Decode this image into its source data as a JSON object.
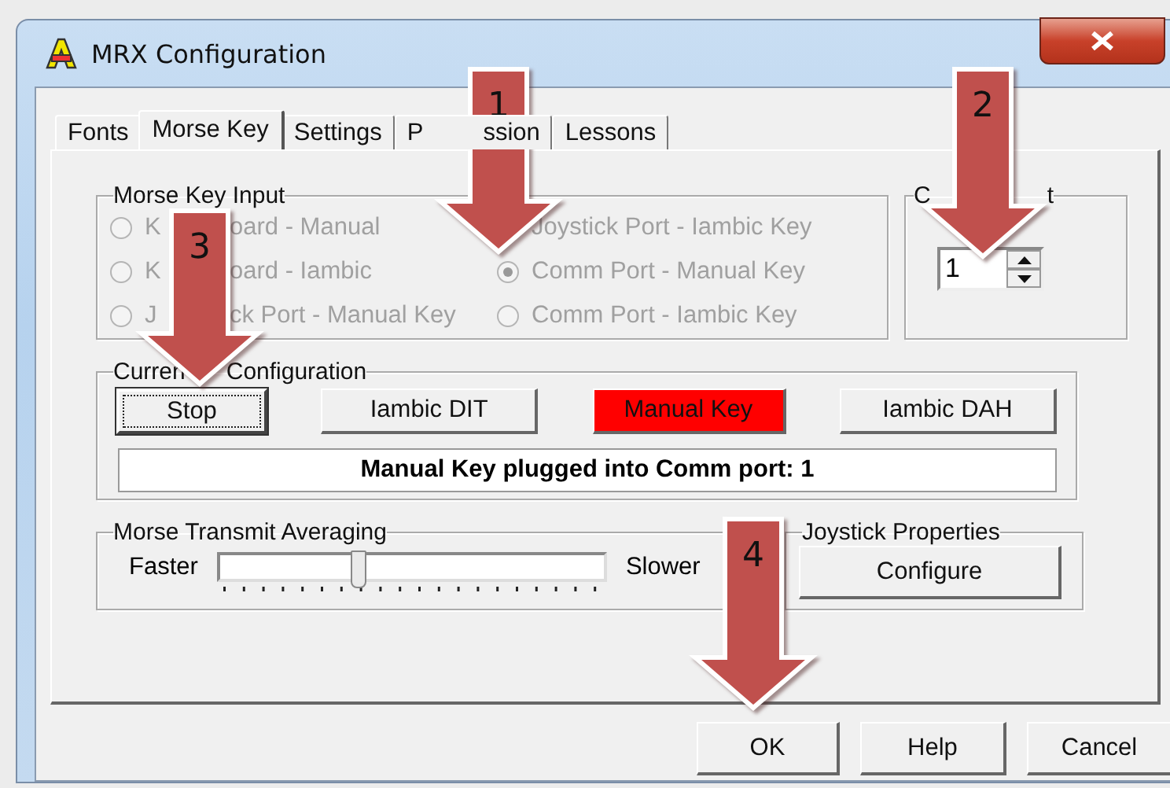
{
  "window": {
    "title": "MRX Configuration"
  },
  "tabs": [
    {
      "label": "Fonts",
      "selected": false
    },
    {
      "label": "Morse Key",
      "selected": true
    },
    {
      "label": "Settings",
      "selected": false
    },
    {
      "label": "P",
      "label_after": "ssion",
      "selected": false
    },
    {
      "label": "Lessons",
      "selected": false
    }
  ],
  "morse_key_input": {
    "title": "Morse Key Input",
    "options": [
      {
        "label": "K",
        "label_after": "oard - Manual",
        "selected": false
      },
      {
        "label": "K",
        "label_after": "oard - Iambic",
        "selected": false
      },
      {
        "label": "J",
        "label_after": "ck Port - Manual Key",
        "selected": false
      },
      {
        "label": "Joystick Port - Iambic Key"
      },
      {
        "label": "Comm Port - Manual Key",
        "selected": true
      },
      {
        "label": "Comm Port - Iambic Key",
        "selected": false
      }
    ],
    "disabled": true
  },
  "comm_port": {
    "title": "C",
    "title_after": "t",
    "value": "1"
  },
  "current_configuration": {
    "title": "Curren",
    "title_after": "Configuration",
    "buttons": [
      {
        "label": "Stop",
        "lit": false,
        "focused": true
      },
      {
        "label": "Iambic DIT",
        "lit": false,
        "focused": false
      },
      {
        "label": "Manual Key",
        "lit": true,
        "focused": false
      },
      {
        "label": "Iambic DAH",
        "lit": false,
        "focused": false
      }
    ],
    "status": "Manual Key plugged into Comm port: 1"
  },
  "averaging": {
    "title": "Morse Transmit Averaging",
    "left_label": "Faster",
    "right_label": "Slower",
    "level": 0.36
  },
  "joystick": {
    "title": "Joystick Properties",
    "button": "Configure"
  },
  "buttons": [
    "OK",
    "Help",
    "Cancel"
  ],
  "annotations": [
    {
      "label": "1"
    },
    {
      "label": "2"
    },
    {
      "label": "3"
    },
    {
      "label": "4"
    }
  ]
}
